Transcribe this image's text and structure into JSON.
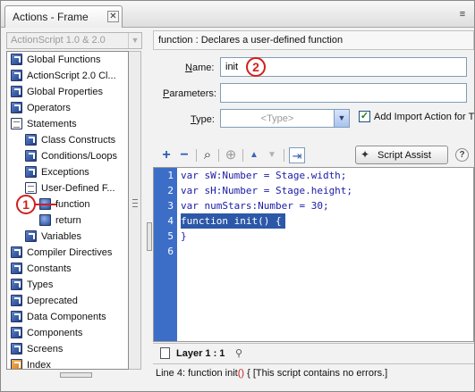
{
  "window": {
    "tab_title": "Actions - Frame",
    "close_glyph": "✕",
    "menu_glyph": "≡"
  },
  "left_pane": {
    "version_select": "ActionScript 1.0 & 2.0",
    "tree_items": [
      {
        "label": "Global Functions",
        "icon": "blue-book-icon",
        "indent": 0
      },
      {
        "label": "ActionScript 2.0 Cl...",
        "icon": "blue-book-icon",
        "indent": 0
      },
      {
        "label": "Global Properties",
        "icon": "blue-book-icon",
        "indent": 0
      },
      {
        "label": "Operators",
        "icon": "blue-book-icon",
        "indent": 0
      },
      {
        "label": "Statements",
        "icon": "open-book-icon",
        "indent": 0
      },
      {
        "label": "Class Constructs",
        "icon": "blue-book-icon",
        "indent": 1
      },
      {
        "label": "Conditions/Loops",
        "icon": "blue-book-icon",
        "indent": 1
      },
      {
        "label": "Exceptions",
        "icon": "blue-book-icon",
        "indent": 1
      },
      {
        "label": "User-Defined F...",
        "icon": "open-book-icon",
        "indent": 1
      },
      {
        "label": "function",
        "icon": "action-circle-icon",
        "indent": 2
      },
      {
        "label": "return",
        "icon": "action-circle-icon",
        "indent": 2
      },
      {
        "label": "Variables",
        "icon": "blue-book-icon",
        "indent": 1
      },
      {
        "label": "Compiler Directives",
        "icon": "blue-book-icon",
        "indent": 0
      },
      {
        "label": "Constants",
        "icon": "blue-book-icon",
        "indent": 0
      },
      {
        "label": "Types",
        "icon": "blue-book-icon",
        "indent": 0
      },
      {
        "label": "Deprecated",
        "icon": "blue-book-icon",
        "indent": 0
      },
      {
        "label": "Data Components",
        "icon": "blue-book-icon",
        "indent": 0
      },
      {
        "label": "Components",
        "icon": "blue-book-icon",
        "indent": 0
      },
      {
        "label": "Screens",
        "icon": "blue-book-icon",
        "indent": 0
      },
      {
        "label": "Index",
        "icon": "orange-book-icon",
        "indent": 0
      }
    ]
  },
  "right_pane": {
    "description": "function : Declares a user-defined function",
    "name_label_prefix": "",
    "name_label_u": "N",
    "name_label_rest": "ame:",
    "name_value": "init",
    "params_label_u": "P",
    "params_label_rest": "arameters:",
    "params_value": "",
    "type_label_u": "T",
    "type_label_rest": "ype:",
    "type_placeholder": "<Type>",
    "import_checkbox_label": "Add Import Action for T",
    "import_checked": true
  },
  "toolbar": {
    "add_glyph": "+",
    "remove_glyph": "−",
    "find_glyph": "⌕",
    "target_glyph": "⊕",
    "up_glyph": "▲",
    "down_glyph": "▼",
    "insert_glyph": "⇥",
    "script_assist_label": "Script Assist",
    "wand_glyph": "✦",
    "help_glyph": "?"
  },
  "editor": {
    "line_numbers": [
      "1",
      "2",
      "3",
      "4",
      "5",
      "6"
    ],
    "lines": [
      "var sW:Number = Stage.width;",
      "var sH:Number = Stage.height;",
      "var numStars:Number = 30;",
      "function init() {",
      "}",
      ""
    ],
    "highlighted_line": 4
  },
  "layer_tab": {
    "label": "Layer 1 : 1",
    "pin_glyph": "⚲"
  },
  "status": {
    "prefix": "Line 4: function init",
    "highlight": "()",
    "suffix": " { [This script contains no errors.]"
  },
  "callouts": {
    "one": "1",
    "two": "2"
  },
  "colors": {
    "gutter": "#3c6ec8",
    "highlight": "#2d58a8",
    "callout": "#d21f1f"
  }
}
